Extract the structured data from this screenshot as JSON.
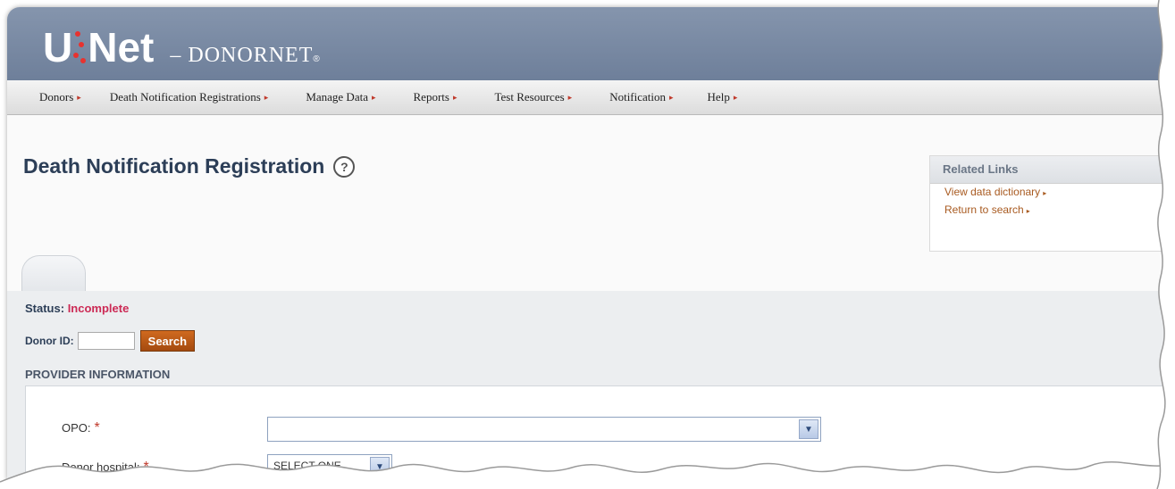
{
  "app": {
    "logo_main": "U",
    "logo_net": "Net",
    "logo_sub": "– DONORNET",
    "logo_reg": "®"
  },
  "nav": {
    "items": [
      {
        "label": "Donors"
      },
      {
        "label": "Death Notification Registrations"
      },
      {
        "label": "Manage Data"
      },
      {
        "label": "Reports"
      },
      {
        "label": "Test Resources"
      },
      {
        "label": "Notification"
      },
      {
        "label": "Help"
      }
    ],
    "arrow": "▸"
  },
  "page": {
    "title": "Death Notification Registration",
    "help_glyph": "?"
  },
  "related_links": {
    "title": "Related Links",
    "links": [
      {
        "label": "View data dictionary"
      },
      {
        "label": "Return to search"
      }
    ]
  },
  "status": {
    "label": "Status:",
    "value": "Incomplete"
  },
  "donor": {
    "label": "Donor ID:",
    "value": "",
    "search_label": "Search"
  },
  "provider": {
    "title": "PROVIDER INFORMATION",
    "opo_label": "OPO:",
    "opo_value": "",
    "hospital_label": "Donor hospital:",
    "hospital_value": "SELECT ONE",
    "required_mark": "*"
  },
  "colors": {
    "header": "#7a8aa4",
    "accent": "#c0392b",
    "status": "#cc2a55",
    "link": "#a85a20",
    "title": "#2c3e57",
    "button": "#b85515"
  },
  "icons": {
    "help": "question-circle-icon",
    "dropdown": "chevron-down-icon",
    "nav_arrow": "arrow-right-icon"
  }
}
